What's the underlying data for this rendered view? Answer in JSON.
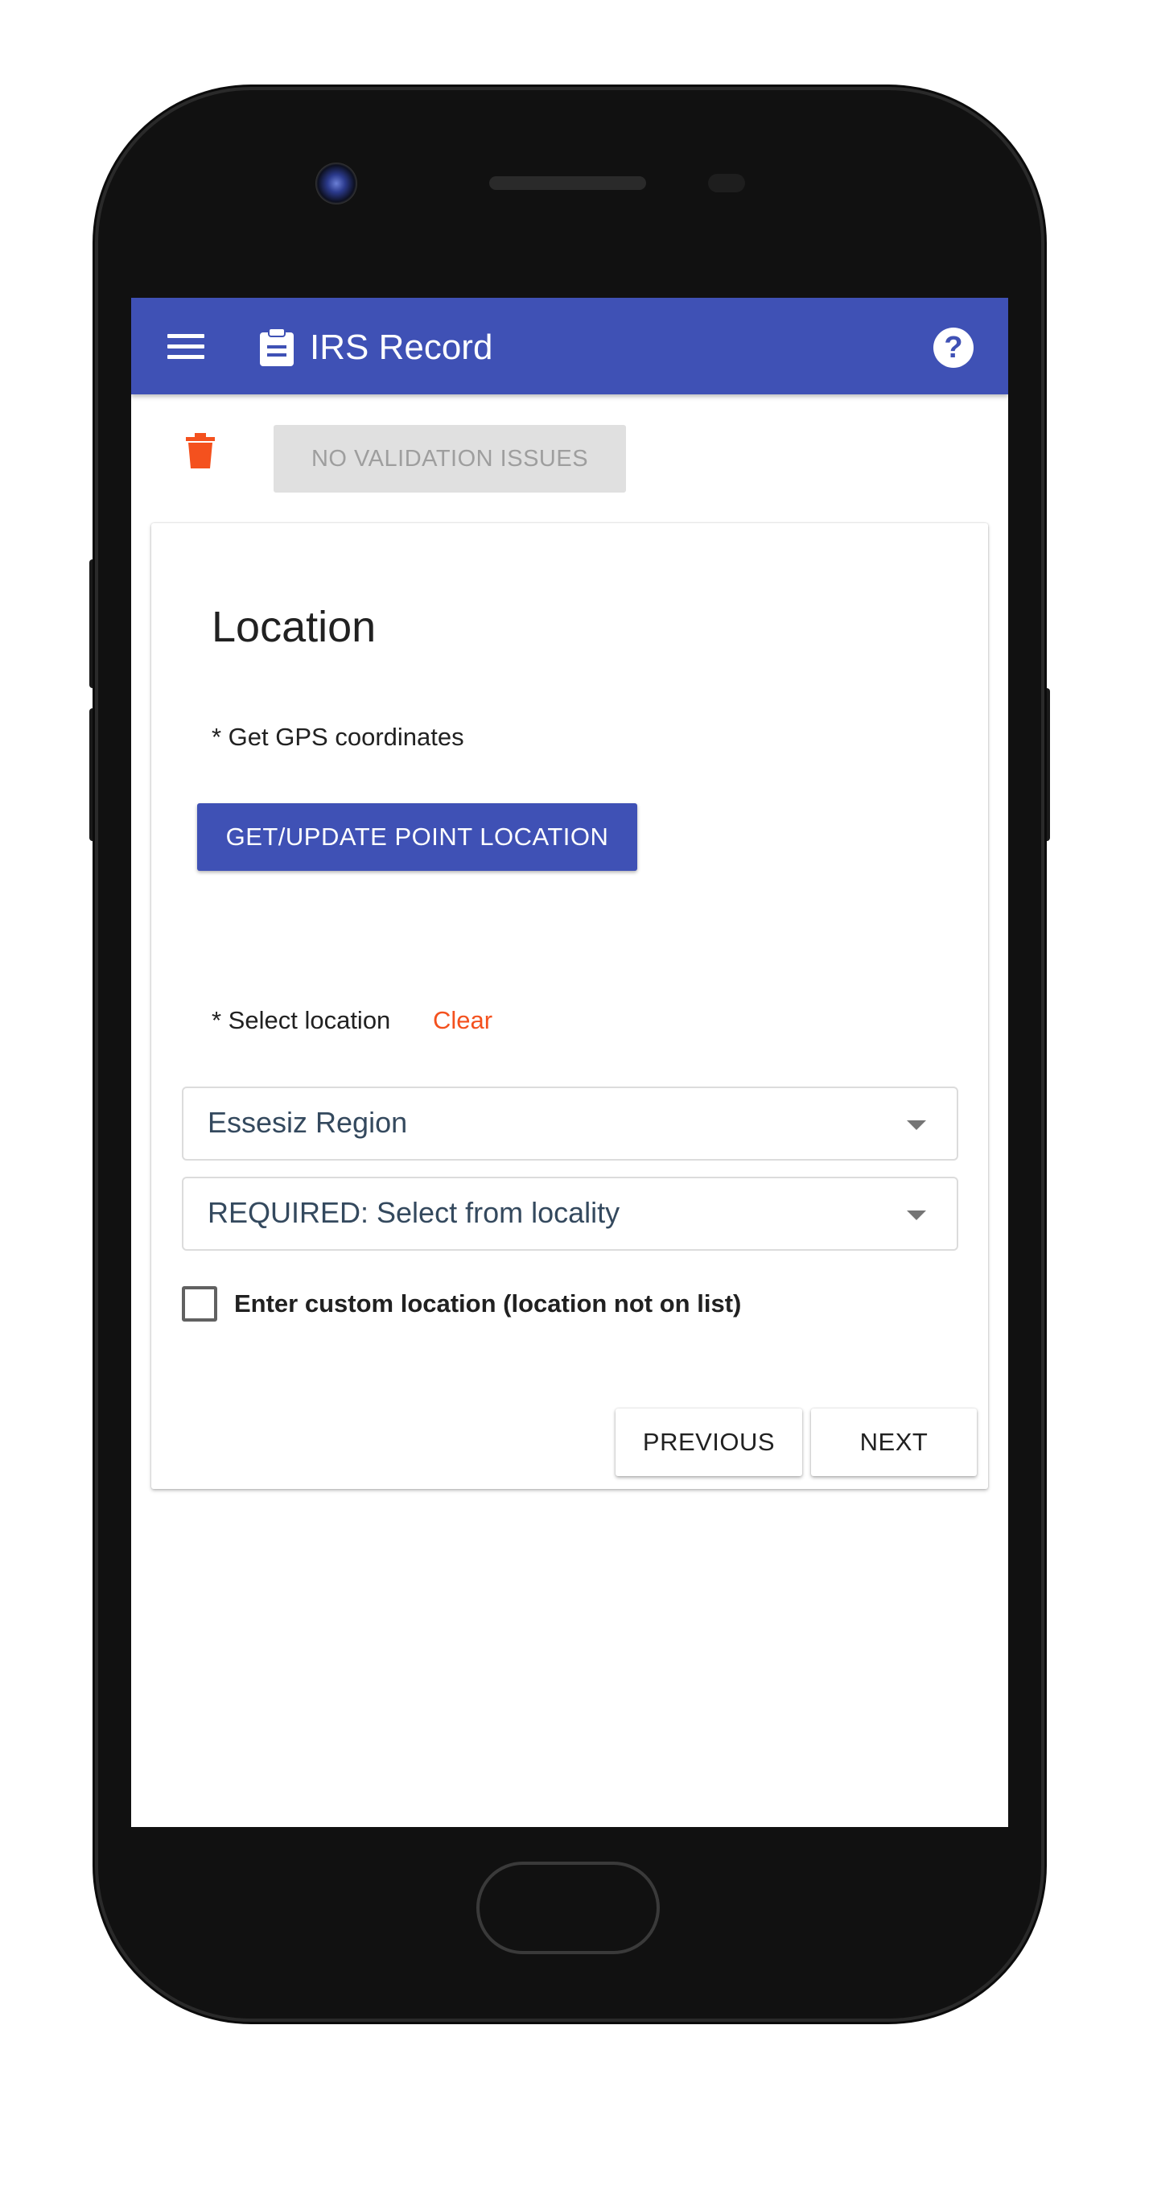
{
  "app_bar": {
    "title": "IRS Record"
  },
  "toolbar": {
    "validation_label": "NO VALIDATION ISSUES"
  },
  "form": {
    "section_title": "Location",
    "gps_label": "* Get GPS coordinates",
    "gps_button_label": "GET/UPDATE POINT LOCATION",
    "select_location_label": "* Select location",
    "clear_label": "Clear",
    "region_dropdown_value": "Essesiz Region",
    "locality_dropdown_value": "REQUIRED: Select from locality",
    "custom_location_label": "Enter custom location (location not on list)",
    "custom_location_checked": false
  },
  "navigation": {
    "previous_label": "PREVIOUS",
    "next_label": "NEXT"
  },
  "colors": {
    "primary": "#3f51b5",
    "accent": "#f4511e",
    "disabled_bg": "#e0e0e0",
    "disabled_text": "#9e9e9e"
  },
  "icons": {
    "menu": "menu-icon",
    "record": "clipboard-icon",
    "help": "help-icon",
    "delete": "trash-icon",
    "dropdown": "caret-down-icon"
  }
}
